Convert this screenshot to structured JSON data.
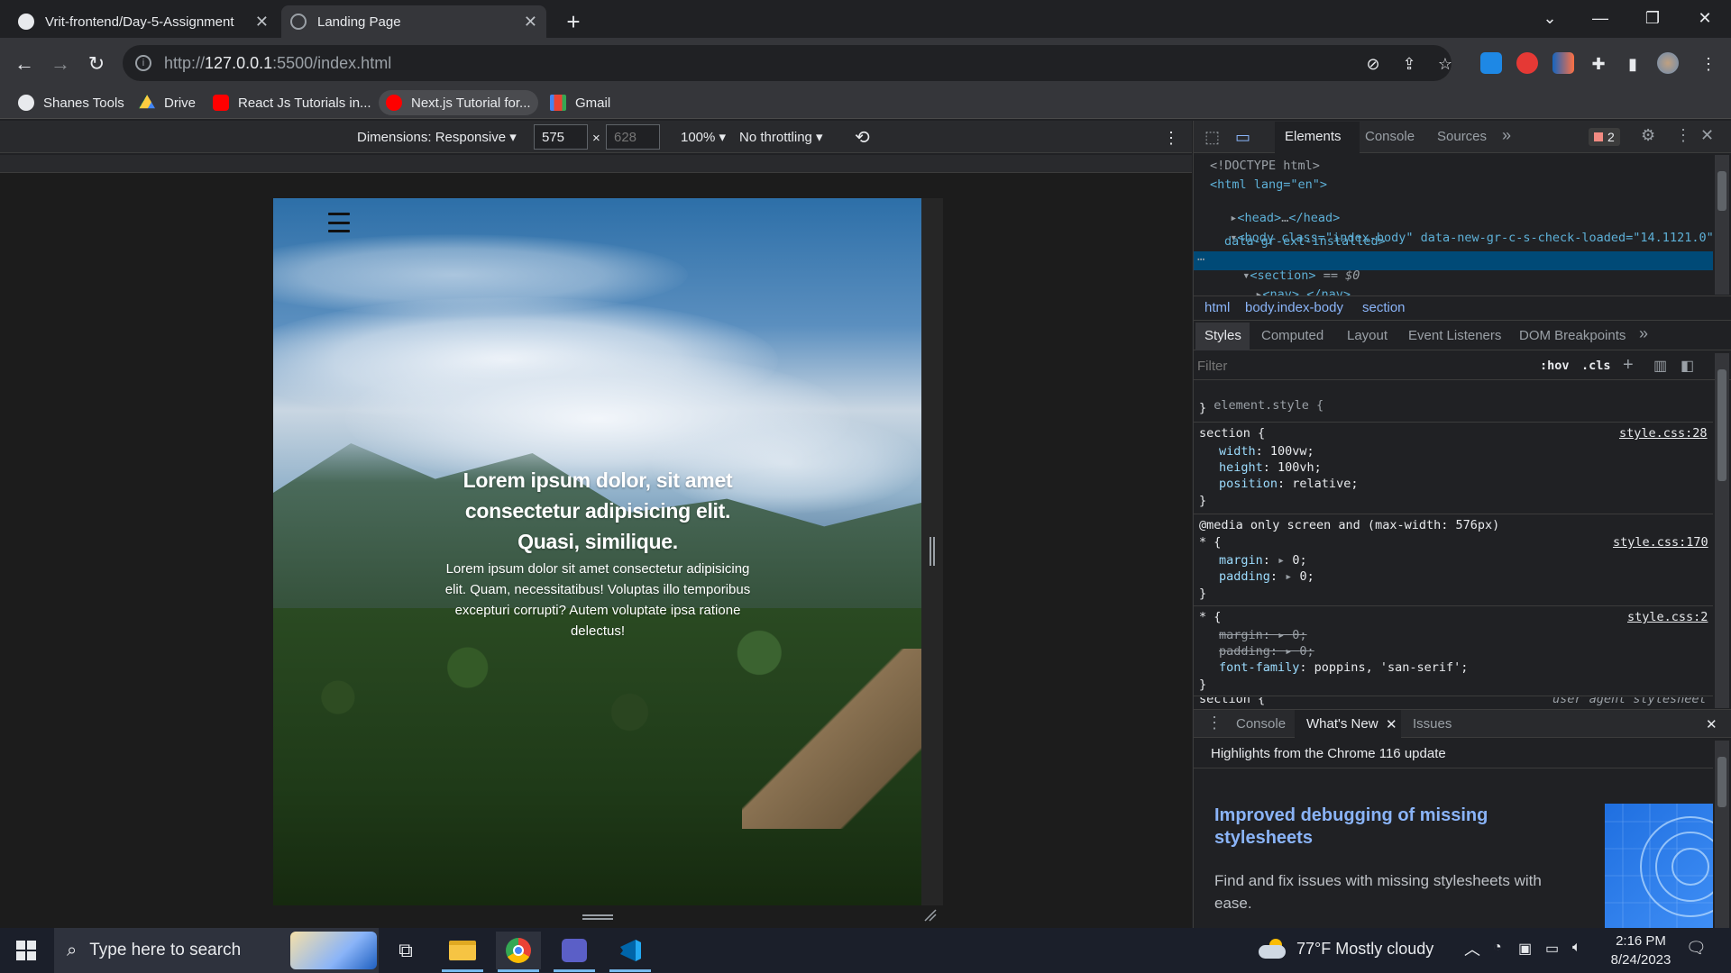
{
  "browser": {
    "tabs": [
      {
        "title": "Vrit-frontend/Day-5-Assignment",
        "icon": "github-icon",
        "active": false
      },
      {
        "title": "Landing Page",
        "icon": "globe-icon",
        "active": true
      }
    ],
    "address": {
      "host": "127.0.0.1",
      "rest": ":5500/index.html",
      "prefix": "http://"
    },
    "bookmarks": [
      {
        "label": "Shanes Tools",
        "icon": "github-icon"
      },
      {
        "label": "Drive",
        "icon": "google-drive-icon"
      },
      {
        "label": "React Js Tutorials in...",
        "icon": "youtube-icon"
      },
      {
        "label": "Next.js Tutorial for...",
        "icon": "youtube-icon"
      },
      {
        "label": "Gmail",
        "icon": "gmail-icon"
      }
    ]
  },
  "device_toolbar": {
    "dimensions": "Dimensions: Responsive",
    "width": "575",
    "times": "×",
    "height_placeholder": "628",
    "zoom": "100%",
    "throttling": "No throttling"
  },
  "page": {
    "hero_title": "Lorem ipsum dolor, sit amet consectetur adipisicing elit. Quasi, similique.",
    "hero_text": "Lorem ipsum dolor sit amet consectetur adipisicing elit. Quam, necessitatibus! Voluptas illo temporibus excepturi corrupti? Autem voluptate ipsa ratione delectus!"
  },
  "devtools": {
    "tabs": [
      "Elements",
      "Console",
      "Sources"
    ],
    "more": "»",
    "error_count": "2",
    "dom": {
      "doctype": "<!DOCTYPE html>",
      "html_open": "<html lang=\"en\">",
      "head": "<head>",
      "head_close": "</head>",
      "body_open": "<body class=\"index-body\" data-new-gr-c-s-check-loaded=\"14.1121.0\"",
      "body_attr2": "data-gr-ext-installed>",
      "section": "<section>",
      "section_eq": "== $0",
      "nav": "<nav>",
      "nav_close": "</nav>",
      "ellipsis": "…"
    },
    "breadcrumbs": [
      "html",
      "body.index-body",
      "section"
    ],
    "subtabs": [
      "Styles",
      "Computed",
      "Layout",
      "Event Listeners",
      "DOM Breakpoints"
    ],
    "filter_placeholder": "Filter",
    "hov": ":hov",
    "cls": ".cls",
    "rules": {
      "element_style": "element.style {",
      "close": "}",
      "section_selector": "section {",
      "section_src": "style.css:28",
      "section_props": [
        {
          "name": "width",
          "value": "100vw;"
        },
        {
          "name": "height",
          "value": "100vh;"
        },
        {
          "name": "position",
          "value": "relative;"
        }
      ],
      "media": "@media only screen and (max-width: 576px)",
      "star_selector": "* {",
      "media_src": "style.css:170",
      "media_props": [
        {
          "name": "margin",
          "value": "0;"
        },
        {
          "name": "padding",
          "value": "0;"
        }
      ],
      "star2_src": "style.css:2",
      "star2_props": [
        {
          "name": "margin",
          "value": "0;"
        },
        {
          "name": "padding",
          "value": "0;"
        },
        {
          "name": "font-family",
          "value": "poppins, 'san-serif';"
        }
      ],
      "cut_selector": "section {",
      "cut_src": "user agent stylesheet"
    },
    "drawer": {
      "tabs": [
        "Console",
        "What's New",
        "Issues"
      ],
      "headline": "Highlights from the Chrome 116 update",
      "card_title": "Improved debugging of missing stylesheets",
      "card_text": "Find and fix issues with missing stylesheets with ease."
    }
  },
  "taskbar": {
    "search_placeholder": "Type here to search",
    "weather": "77°F  Mostly cloudy",
    "time": "2:16 PM",
    "date": "8/24/2023"
  },
  "colors": {
    "accent": "#8ab4f8",
    "selection": "#004a77"
  }
}
